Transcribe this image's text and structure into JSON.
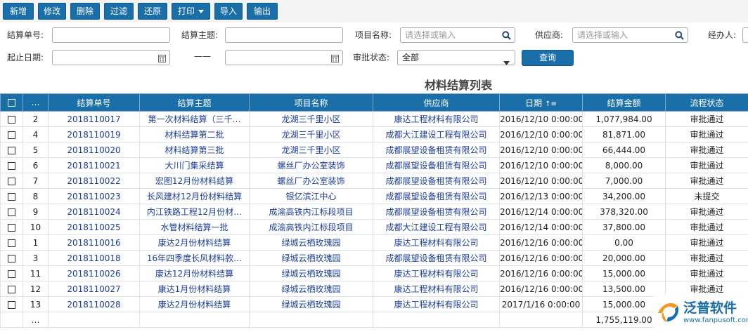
{
  "toolbar": {
    "new": "新增",
    "edit": "修改",
    "delete": "删除",
    "filter": "过滤",
    "restore": "还原",
    "print": "打印",
    "import": "导入",
    "export": "输出"
  },
  "filters": {
    "settle_no_label": "结算单号:",
    "settle_subject_label": "结算主题:",
    "project_label": "项目名称:",
    "project_placeholder": "请选择或输入",
    "supplier_label": "供应商:",
    "supplier_placeholder": "请选择或输入",
    "handler_label": "经办人:",
    "date_label": "起止日期:",
    "date_sep": "——",
    "status_label": "审批状态:",
    "status_value": "全部",
    "query_button": "查询"
  },
  "table": {
    "title": "材料结算列表",
    "columns": [
      "…",
      "结算单号",
      "结算主题",
      "项目名称",
      "供应商",
      "日期",
      "结算金额",
      "流程状态"
    ],
    "rows": [
      {
        "idx": "2",
        "no": "2018110017",
        "subject": "第一次材料结算（三千…",
        "project": "龙湖三千里小区",
        "supplier": "康达工程材料有限公司",
        "date": "2016/12/10 0:00:00",
        "amount": "1,077,984.00",
        "status": "审批通过"
      },
      {
        "idx": "4",
        "no": "2018110019",
        "subject": "材料结算第二批",
        "project": "龙湖三千里小区",
        "supplier": "成都大江建设工程有限公司",
        "date": "2016/12/10 0:00:00",
        "amount": "81,871.00",
        "status": "审批通过"
      },
      {
        "idx": "5",
        "no": "2018110020",
        "subject": "材料结算第三批",
        "project": "龙湖三千里小区",
        "supplier": "成都展望设备租赁有限公司",
        "date": "2016/12/10 0:00:00",
        "amount": "66,444.00",
        "status": "审批通过"
      },
      {
        "idx": "6",
        "no": "2018110021",
        "subject": "大川门集采结算",
        "project": "螺丝厂办公室装饰",
        "supplier": "成都展望设备租赁有限公司",
        "date": "2016/12/10 0:00:00",
        "amount": "8,000.00",
        "status": "审批通过"
      },
      {
        "idx": "7",
        "no": "2018110022",
        "subject": "宏图12月份材料结算",
        "project": "螺丝厂办公室装饰",
        "supplier": "成都展望设备租赁有限公司",
        "date": "2016/12/10 0:00:00",
        "amount": "7,000.00",
        "status": "审批通过"
      },
      {
        "idx": "8",
        "no": "2018110023",
        "subject": "长风建材12月份材料结算",
        "project": "银亿滨江中心",
        "supplier": "成都展望设备租赁有限公司",
        "date": "2016/12/13 0:00:00",
        "amount": "34,200.00",
        "status": "未提交"
      },
      {
        "idx": "9",
        "no": "2018110024",
        "subject": "内江铁路工程12月份材…",
        "project": "成渝高铁内江标段项目",
        "supplier": "成都展望设备租赁有限公司",
        "date": "2016/12/14 0:00:00",
        "amount": "378,320.00",
        "status": "审批通过"
      },
      {
        "idx": "10",
        "no": "2018110025",
        "subject": "水管材料结算一批",
        "project": "成渝高铁内江标段项目",
        "supplier": "成都大江建设工程有限公司",
        "date": "2016/12/14 0:00:00",
        "amount": "37,800.00",
        "status": "审批通过"
      },
      {
        "idx": "1",
        "no": "2018110016",
        "subject": "康达2月份材料结算",
        "project": "绿城云栖玫瑰园",
        "supplier": "康达工程材料有限公司",
        "date": "2016/12/16 0:00:00",
        "amount": "0.00",
        "status": "审批通过"
      },
      {
        "idx": "3",
        "no": "2018110018",
        "subject": "16年四季度长风材料款…",
        "project": "绿城云栖玫瑰园",
        "supplier": "成都展望设备租赁有限公司",
        "date": "2016/12/16 0:00:00",
        "amount": "20,000.00",
        "status": "审批通过"
      },
      {
        "idx": "11",
        "no": "2018110026",
        "subject": "康达12月份材料结算",
        "project": "绿城云栖玫瑰园",
        "supplier": "康达工程材料有限公司",
        "date": "2016/12/16 0:00:00",
        "amount": "15,000.00",
        "status": "审批通过"
      },
      {
        "idx": "12",
        "no": "2018110027",
        "subject": "康达1月份材料结算",
        "project": "绿城云栖玫瑰园",
        "supplier": "康达工程材料有限公司",
        "date": "2016/12/16 0:00:00",
        "amount": "13,500.00",
        "status": "审批通过"
      },
      {
        "idx": "13",
        "no": "2018110028",
        "subject": "康达2月份材料结算",
        "project": "绿城云栖玫瑰园",
        "supplier": "康达工程材料有限公司",
        "date": "2017/1/16 0:00:00",
        "amount": "15,000.00",
        "status": "审批通过"
      }
    ],
    "footer_idx": "…",
    "total": "1,755,119.00"
  },
  "logo": {
    "name": "泛普软件",
    "url": "www.fanpusoft.com"
  },
  "colors": {
    "primary": "#1a6fa8",
    "link": "#1c3d9b",
    "logo_orange": "#f39a1e"
  }
}
